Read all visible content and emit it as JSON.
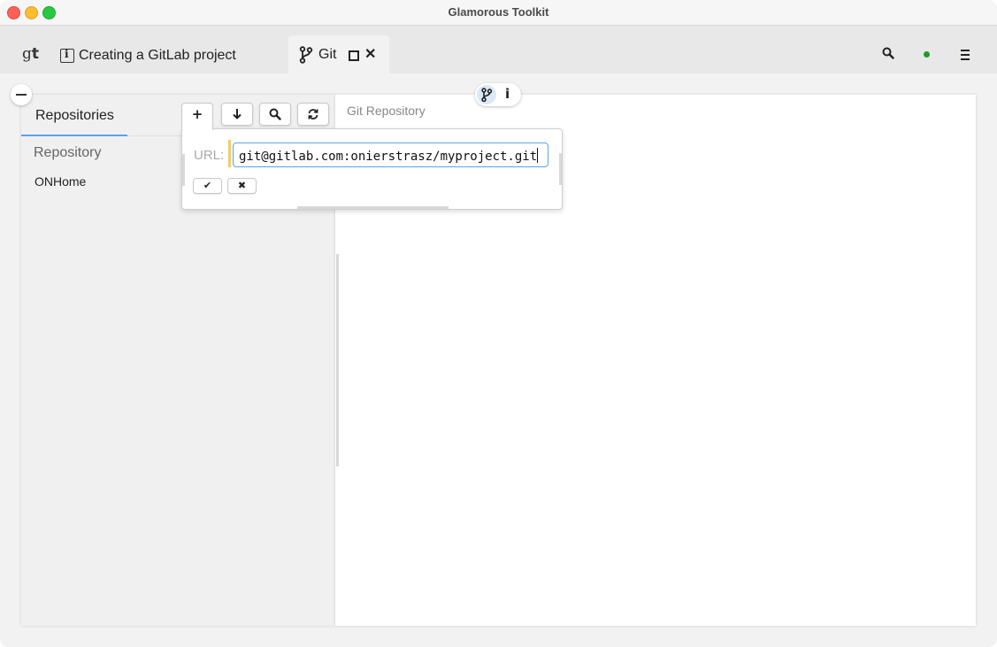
{
  "window": {
    "title": "Glamorous Toolkit"
  },
  "tabs": {
    "home_logo": "g",
    "home_logo_bold": "t",
    "doc_tab_label": "Creating a GitLab project",
    "git_tab_label": "Git"
  },
  "icons": {
    "search": "search-icon",
    "status": "status-dot-icon",
    "menu": "hamburger-menu-icon",
    "branch": "git-branch-icon",
    "info": "info-icon"
  },
  "left_pane": {
    "tab_label": "Repositories",
    "column_header": "Repository",
    "rows": [
      "ONHome"
    ]
  },
  "right_pane": {
    "subtitle": "Git Repository",
    "info_glyph": "i"
  },
  "toolbar": {
    "add_glyph": "+",
    "clone_glyph": "↓",
    "search_glyph": "🔍",
    "refresh_glyph": "⟳"
  },
  "popup": {
    "url_label": "URL:",
    "url_value": "git@gitlab.com:onierstrasz/myproject.git",
    "accept_glyph": "✔",
    "cancel_glyph": "✖"
  },
  "colors": {
    "accent": "#5aa3e8",
    "status_green": "#1f9a2e",
    "marker_yellow": "#f3cc63"
  }
}
